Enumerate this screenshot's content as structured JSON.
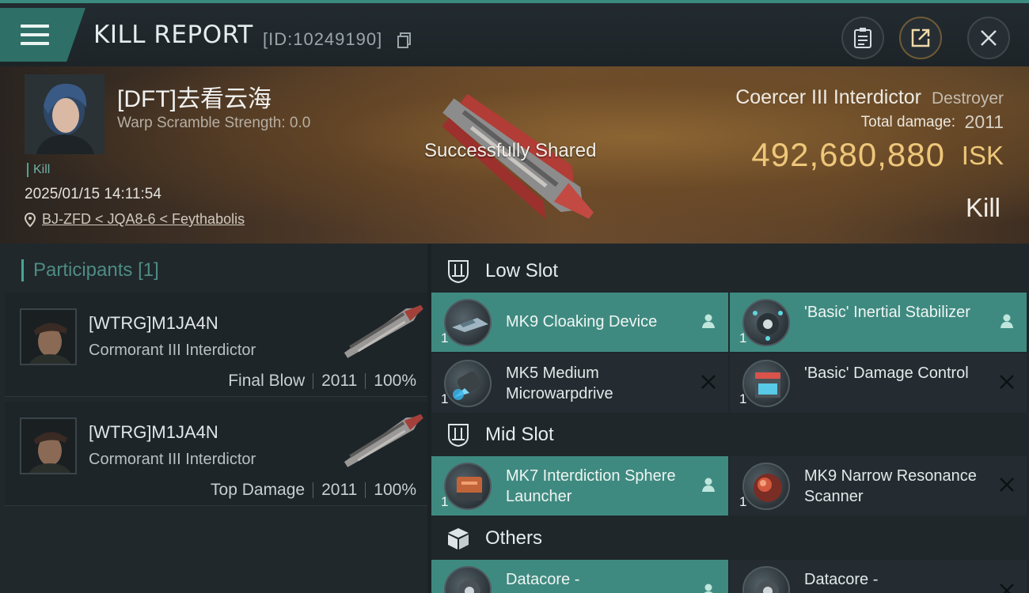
{
  "header": {
    "title": "KILL REPORT",
    "report_id": "[ID:10249190]"
  },
  "victim": {
    "pilot_name": "[DFT]去看云海",
    "warp_scramble": "Warp Scramble Strength: 0.0",
    "kill_tag": "Kill",
    "datetime": "2025/01/15 14:11:54",
    "location": "BJ-ZFD < JQA8-6 < Feythabolis",
    "ship_name": "Coercer III Interdictor",
    "ship_class": "Destroyer",
    "total_damage_label": "Total damage:",
    "total_damage": "2011",
    "isk_value": "492,680,880",
    "isk_unit": "ISK",
    "result": "Kill",
    "toast": "Successfully Shared"
  },
  "participants": {
    "header": "Participants",
    "count": "[1]",
    "rows": [
      {
        "name": "[WTRG]M1JA4N",
        "ship": "Cormorant III Interdictor",
        "role": "Final Blow",
        "damage": "2011",
        "percent": "100%"
      },
      {
        "name": "[WTRG]M1JA4N",
        "ship": "Cormorant III Interdictor",
        "role": "Top Damage",
        "damage": "2011",
        "percent": "100%"
      }
    ]
  },
  "slots": {
    "low": {
      "label": "Low Slot",
      "items": [
        {
          "name": "MK9 Cloaking Device",
          "qty": "1",
          "status": "person-icon",
          "fitted": true
        },
        {
          "name": "'Basic' Inertial Stabilizer",
          "qty": "1",
          "status": "person-icon",
          "fitted": true
        },
        {
          "name": "MK5 Medium Microwarpdrive",
          "qty": "1",
          "status": "destroyed-x-icon",
          "fitted": false
        },
        {
          "name": "'Basic' Damage Control",
          "qty": "1",
          "status": "destroyed-x-icon",
          "fitted": false
        }
      ]
    },
    "mid": {
      "label": "Mid Slot",
      "items": [
        {
          "name": "MK7 Interdiction Sphere Launcher",
          "qty": "1",
          "status": "person-icon",
          "fitted": true
        },
        {
          "name": "MK9 Narrow Resonance Scanner",
          "qty": "1",
          "status": "destroyed-x-icon",
          "fitted": false
        }
      ]
    },
    "others": {
      "label": "Others",
      "items": [
        {
          "name": "Datacore -",
          "qty": "",
          "status": "person-icon",
          "fitted": true
        },
        {
          "name": "Datacore -",
          "qty": "",
          "status": "destroyed-x-icon",
          "fitted": false
        }
      ]
    }
  },
  "colors": {
    "accent_teal": "#3f8a80",
    "isk_gold": "#eec77a",
    "background": "#1b2226"
  }
}
